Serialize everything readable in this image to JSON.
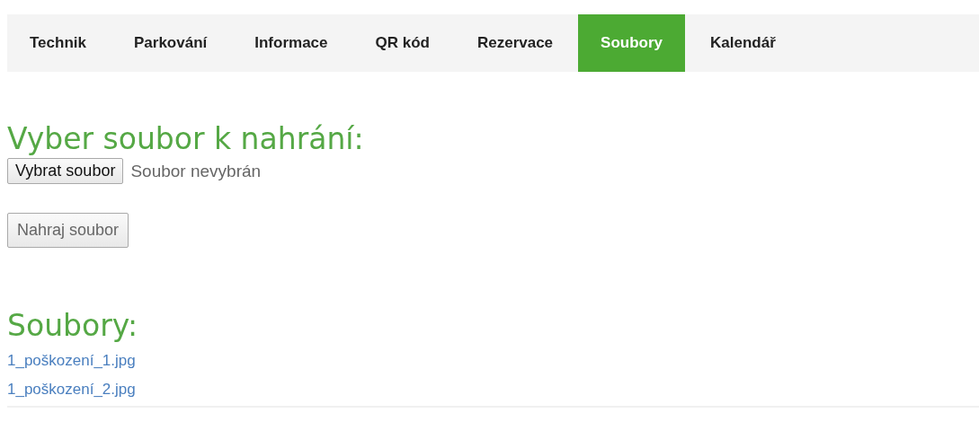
{
  "tabs": [
    {
      "label": "Technik",
      "selected": false
    },
    {
      "label": "Parkování",
      "selected": false
    },
    {
      "label": "Informace",
      "selected": false
    },
    {
      "label": "QR kód",
      "selected": false
    },
    {
      "label": "Rezervace",
      "selected": false
    },
    {
      "label": "Soubory",
      "selected": true
    },
    {
      "label": "Kalendář",
      "selected": false
    }
  ],
  "upload": {
    "heading": "Vyber soubor k nahrání:",
    "choose_button": "Vybrat soubor",
    "file_status": "Soubor nevybrán",
    "upload_button": "Nahraj soubor"
  },
  "files": {
    "heading": "Soubory:",
    "items": [
      "1_poškození_1.jpg",
      "1_poškození_2.jpg"
    ]
  }
}
